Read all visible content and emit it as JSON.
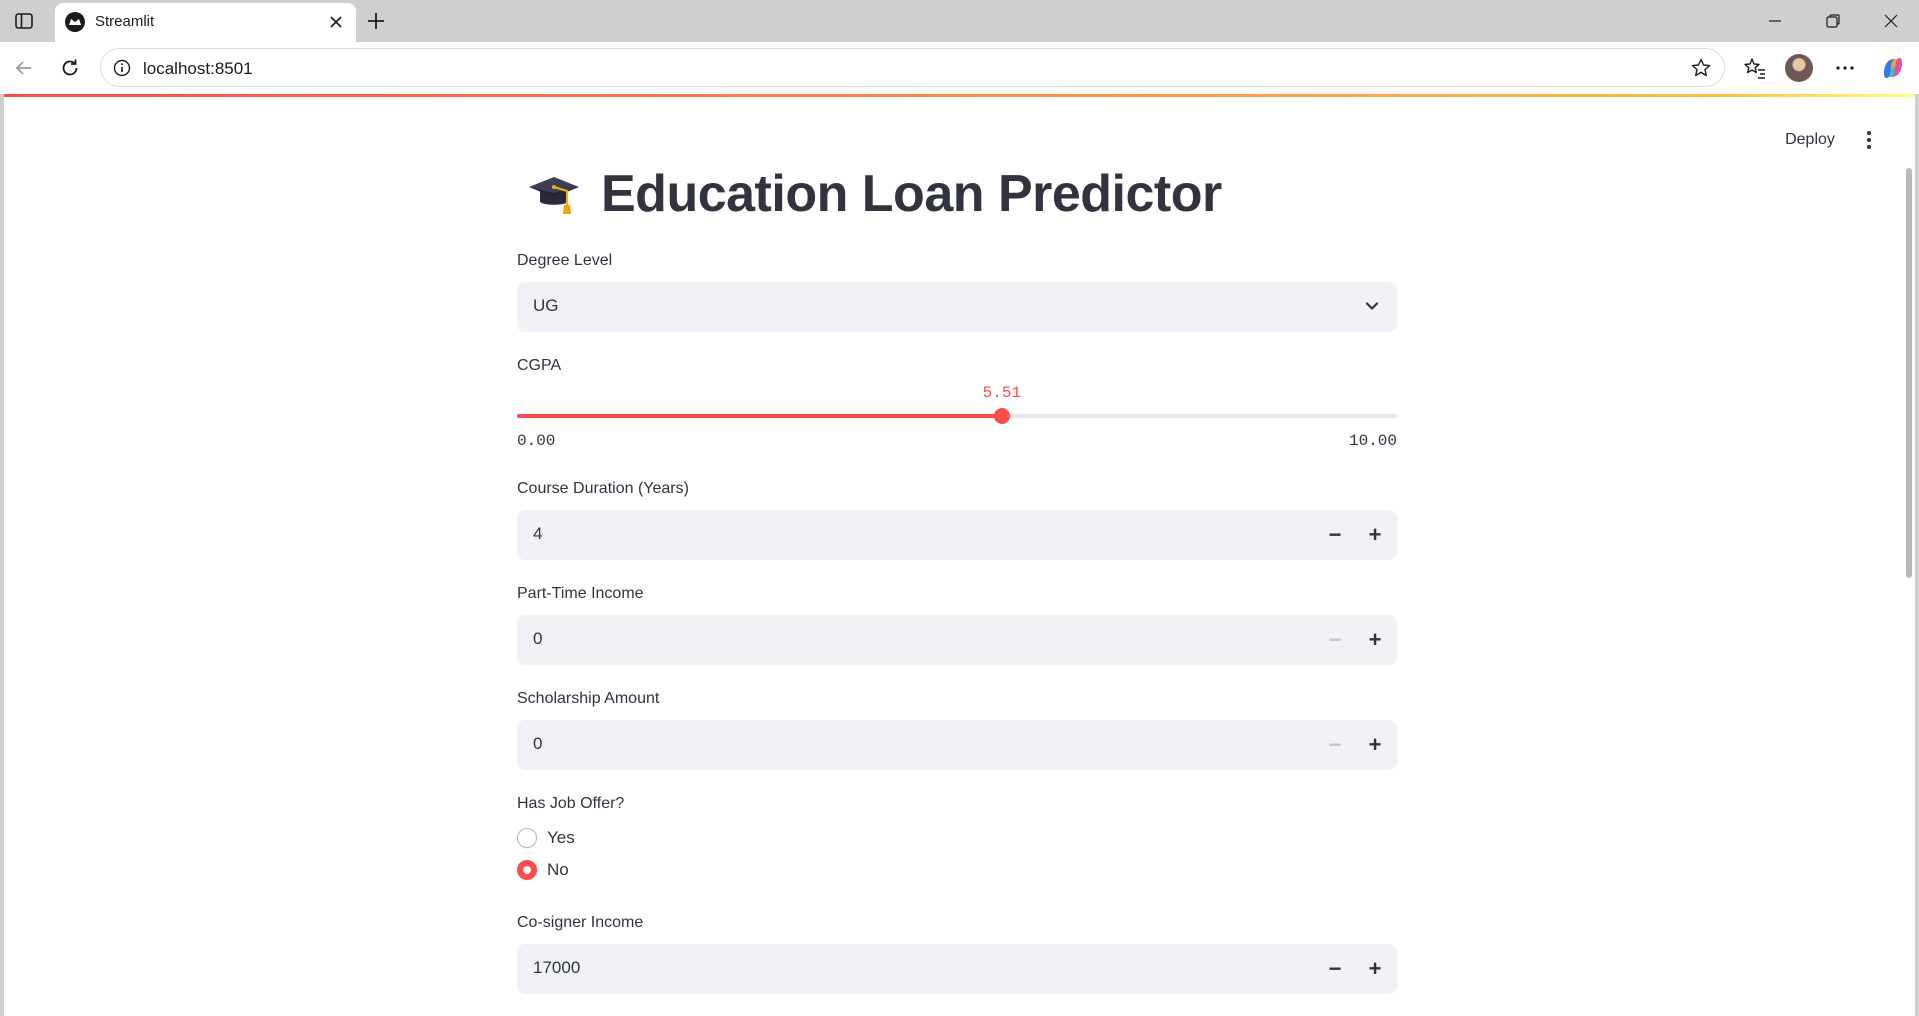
{
  "browser": {
    "tab_title": "Streamlit",
    "url": "localhost:8501"
  },
  "app": {
    "deploy_label": "Deploy",
    "title": "Education Loan Predictor",
    "title_icon": "graduation-cap-icon"
  },
  "form": {
    "degree_level": {
      "label": "Degree Level",
      "value": "UG"
    },
    "cgpa": {
      "label": "CGPA",
      "value": "5.51",
      "min": "0.00",
      "max": "10.00",
      "fraction": 0.551
    },
    "course_duration": {
      "label": "Course Duration (Years)",
      "value": "4"
    },
    "part_time_income": {
      "label": "Part-Time Income",
      "value": "0"
    },
    "scholarship_amount": {
      "label": "Scholarship Amount",
      "value": "0"
    },
    "has_job_offer": {
      "label": "Has Job Offer?",
      "options": [
        "Yes",
        "No"
      ],
      "selected": "No"
    },
    "cosigner_income": {
      "label": "Co-signer Income",
      "value": "17000"
    }
  },
  "colors": {
    "accent": "#ff4b4b",
    "text": "#31333f",
    "input_bg": "#f0f2f6"
  }
}
